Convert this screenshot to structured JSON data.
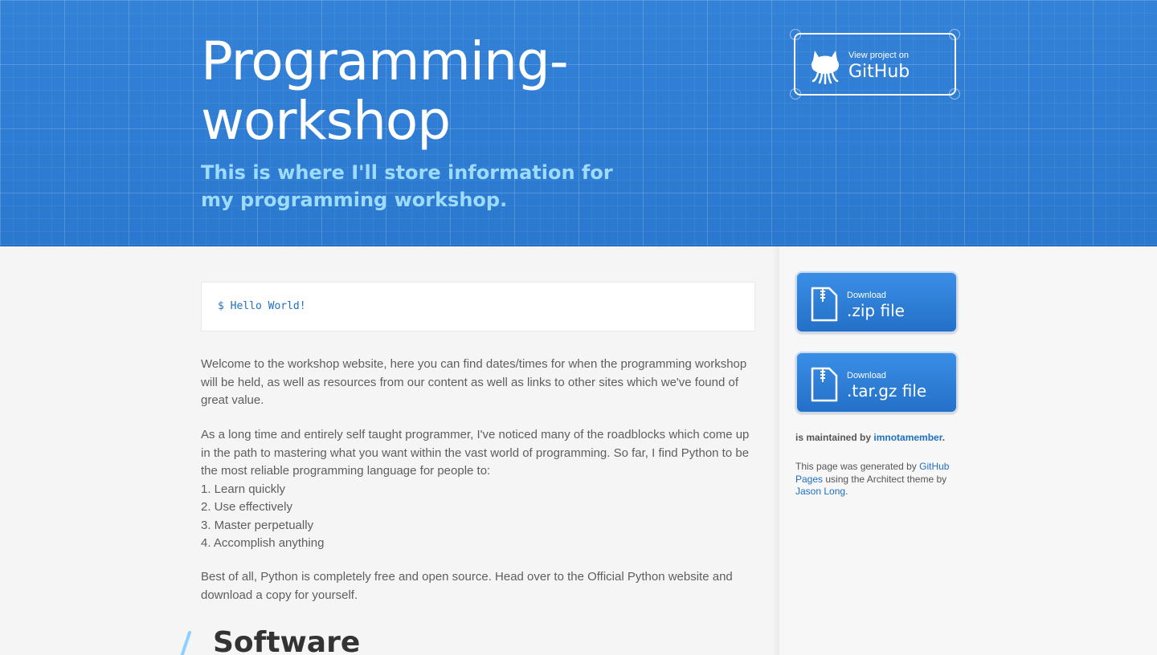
{
  "header": {
    "title": "Programming-workshop",
    "tagline": "This is where I'll store information for my programming workshop.",
    "github_button": {
      "small": "View project on",
      "big": "GitHub",
      "icon": "octocat-icon"
    }
  },
  "main": {
    "code": "$ Hello World!",
    "paragraph1": "Welcome to the workshop website, here you can find dates/times for when the programming workshop will be held, as well as resources from our content as well as links to other sites which we've found of great value.",
    "paragraph2_intro": "As a long time and entirely self taught programmer, I've noticed many of the roadblocks which come up in the path to mastering what you want within the vast world of programming. So far, I find Python to be the most reliable programming language for people to:",
    "list": [
      "1. Learn quickly",
      "2. Use effectively",
      "3. Master perpetually",
      "4. Accomplish anything"
    ],
    "paragraph3": "Best of all, Python is completely free and open source. Head over to the Official Python website and download a copy for yourself.",
    "heading_software": "Software"
  },
  "sidebar": {
    "download_zip": {
      "small": "Download",
      "big": ".zip file",
      "icon": "zip-file-icon"
    },
    "download_tar": {
      "small": "Download",
      "big": ".tar.gz file",
      "icon": "zip-file-icon"
    },
    "maintained_prefix": "is maintained by",
    "maintainer": "imnotamember",
    "maintained_suffix": ".",
    "generated_prefix": "This page was generated by",
    "github_pages": "GitHub Pages",
    "generated_mid": "using the Architect theme by",
    "author": "Jason Long",
    "generated_suffix": "."
  },
  "colors": {
    "header_bg": "#2f7fd6",
    "tagline": "#9ddcff",
    "link": "#1d6fc4"
  }
}
